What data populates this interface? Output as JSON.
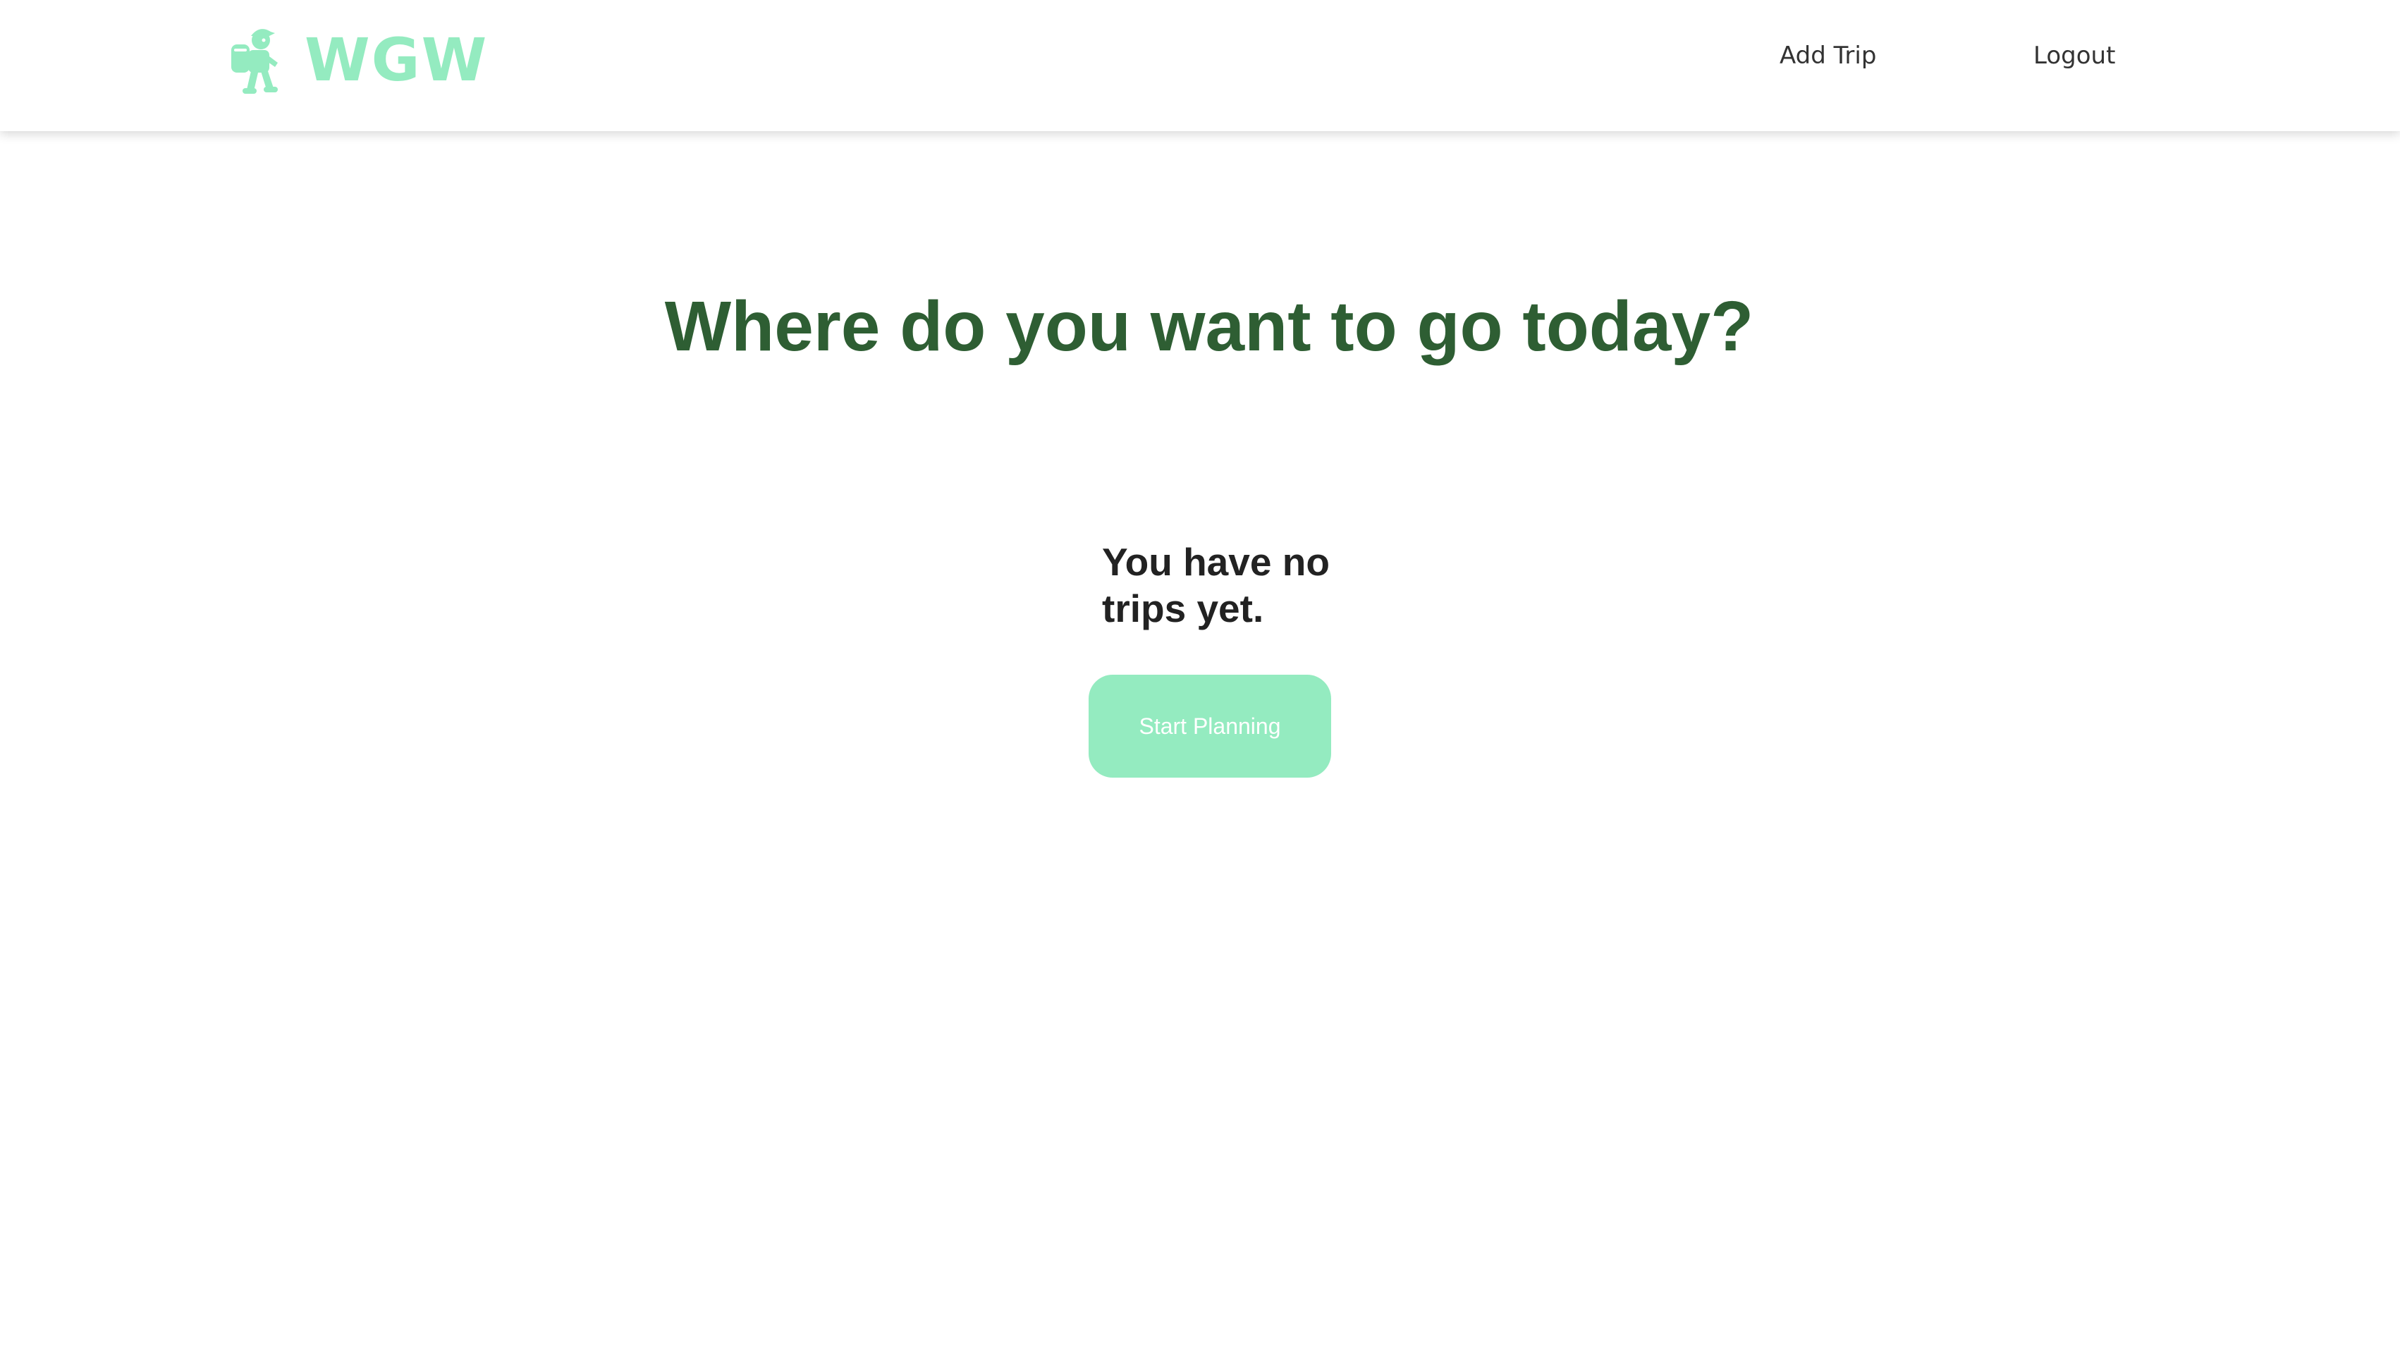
{
  "app": {
    "logo_text": "WGW",
    "brand_color": "#94EBC0",
    "heading_color": "#2E5E33"
  },
  "nav": {
    "items": [
      {
        "label": "Add Trip"
      },
      {
        "label": "Logout"
      }
    ]
  },
  "main": {
    "heading": "Where do you want to go today?",
    "empty_message": "You have no trips yet.",
    "cta_label": "Start Planning"
  }
}
